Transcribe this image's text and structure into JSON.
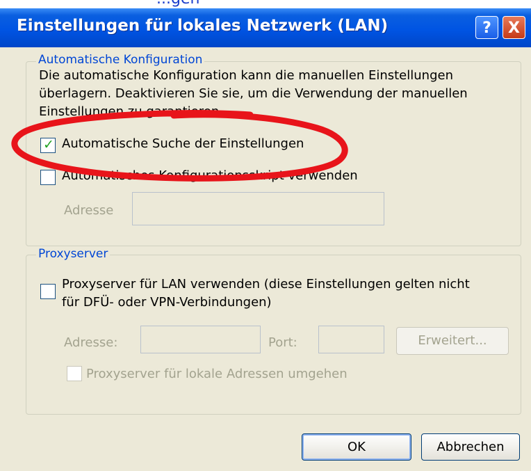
{
  "cut_top_text": "...gen",
  "window": {
    "title": "Einstellungen für lokales Netzwerk (LAN)",
    "help_glyph": "?",
    "close_glyph": "X"
  },
  "auto_config": {
    "legend": "Automatische Konfiguration",
    "description_lines": [
      "Die automatische Konfiguration kann die manuellen Einstellungen",
      "überlagern. Deaktivieren Sie sie, um die Verwendung der manuellen",
      "Einstellungen zu garantieren."
    ],
    "auto_detect": {
      "label": "Automatische Suche der Einstellungen",
      "checked": true
    },
    "auto_script": {
      "label": "Automatisches Konfigurationsskript verwenden",
      "checked": false
    },
    "address_label": "Adresse",
    "address_value": ""
  },
  "proxy": {
    "legend": "Proxyserver",
    "use_proxy": {
      "label_line1": "Proxyserver für LAN verwenden (diese Einstellungen gelten nicht",
      "label_line2": "für DFÜ- oder VPN-Verbindungen)",
      "checked": false
    },
    "address_label": "Adresse:",
    "address_value": "",
    "port_label": "Port:",
    "port_value": "",
    "advanced_label": "Erweitert...",
    "bypass_local": {
      "label": "Proxyserver für lokale Adressen umgehen",
      "checked": false
    }
  },
  "buttons": {
    "ok": "OK",
    "cancel": "Abbrechen"
  },
  "annotation": {
    "color": "#e8141a"
  }
}
